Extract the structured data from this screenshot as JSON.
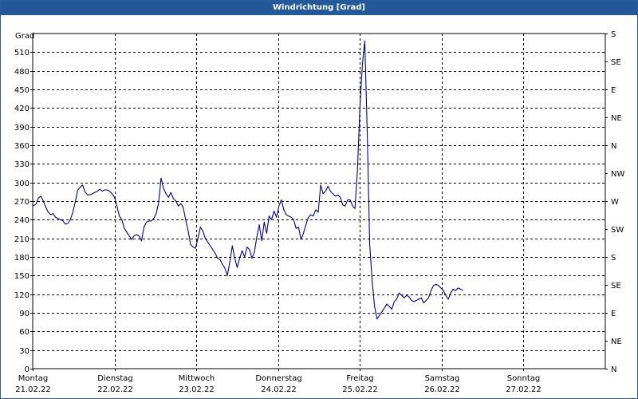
{
  "window": {
    "title": "Windrichtung [Grad]"
  },
  "chart_data": {
    "type": "line",
    "title": "Windrichtung [Grad]",
    "ylabel": "Grad",
    "ylim": [
      0,
      540
    ],
    "y_ticks": [
      0,
      30,
      60,
      90,
      120,
      150,
      180,
      210,
      240,
      270,
      300,
      330,
      360,
      390,
      420,
      450,
      480,
      510
    ],
    "y2_ticks": [
      {
        "value": 0,
        "label": "N"
      },
      {
        "value": 45,
        "label": "NE"
      },
      {
        "value": 90,
        "label": "E"
      },
      {
        "value": 135,
        "label": "SE"
      },
      {
        "value": 180,
        "label": "S"
      },
      {
        "value": 225,
        "label": "SW"
      },
      {
        "value": 270,
        "label": "W"
      },
      {
        "value": 315,
        "label": "NW"
      },
      {
        "value": 360,
        "label": "N"
      },
      {
        "value": 405,
        "label": "NE"
      },
      {
        "value": 450,
        "label": "E"
      },
      {
        "value": 495,
        "label": "SE"
      },
      {
        "value": 540,
        "label": "S"
      }
    ],
    "xlim": [
      0,
      7
    ],
    "x_ticks": [
      {
        "value": 0,
        "day": "Montag",
        "date": "21.02.22"
      },
      {
        "value": 1,
        "day": "Dienstag",
        "date": "22.02.22"
      },
      {
        "value": 2,
        "day": "Mittwoch",
        "date": "23.02.22"
      },
      {
        "value": 3,
        "day": "Donnerstag",
        "date": "24.02.22"
      },
      {
        "value": 4,
        "day": "Freitag",
        "date": "25.02.22"
      },
      {
        "value": 5,
        "day": "Samstag",
        "date": "26.02.22"
      },
      {
        "value": 6,
        "day": "Sonntag",
        "date": "27.02.22"
      }
    ],
    "grid": true,
    "series": [
      {
        "color": "#00008b",
        "points": [
          [
            0.0,
            262
          ],
          [
            0.04,
            265
          ],
          [
            0.07,
            275
          ],
          [
            0.1,
            278
          ],
          [
            0.13,
            270
          ],
          [
            0.16,
            260
          ],
          [
            0.19,
            252
          ],
          [
            0.22,
            248
          ],
          [
            0.25,
            250
          ],
          [
            0.28,
            244
          ],
          [
            0.31,
            242
          ],
          [
            0.34,
            240
          ],
          [
            0.37,
            238
          ],
          [
            0.4,
            233
          ],
          [
            0.43,
            234
          ],
          [
            0.46,
            240
          ],
          [
            0.49,
            252
          ],
          [
            0.52,
            268
          ],
          [
            0.55,
            288
          ],
          [
            0.58,
            292
          ],
          [
            0.61,
            296
          ],
          [
            0.64,
            285
          ],
          [
            0.67,
            280
          ],
          [
            0.7,
            280
          ],
          [
            0.73,
            282
          ],
          [
            0.76,
            284
          ],
          [
            0.79,
            286
          ],
          [
            0.82,
            289
          ],
          [
            0.85,
            286
          ],
          [
            0.88,
            288
          ],
          [
            0.91,
            288
          ],
          [
            0.94,
            286
          ],
          [
            0.97,
            282
          ],
          [
            1.0,
            276
          ],
          [
            1.03,
            262
          ],
          [
            1.06,
            246
          ],
          [
            1.09,
            240
          ],
          [
            1.12,
            226
          ],
          [
            1.15,
            220
          ],
          [
            1.18,
            214
          ],
          [
            1.21,
            208
          ],
          [
            1.24,
            214
          ],
          [
            1.27,
            216
          ],
          [
            1.3,
            214
          ],
          [
            1.33,
            206
          ],
          [
            1.36,
            228
          ],
          [
            1.39,
            236
          ],
          [
            1.42,
            238
          ],
          [
            1.45,
            238
          ],
          [
            1.48,
            242
          ],
          [
            1.51,
            250
          ],
          [
            1.54,
            268
          ],
          [
            1.57,
            307
          ],
          [
            1.6,
            290
          ],
          [
            1.63,
            282
          ],
          [
            1.66,
            276
          ],
          [
            1.69,
            284
          ],
          [
            1.72,
            274
          ],
          [
            1.75,
            270
          ],
          [
            1.78,
            262
          ],
          [
            1.81,
            266
          ],
          [
            1.84,
            260
          ],
          [
            1.87,
            240
          ],
          [
            1.9,
            222
          ],
          [
            1.93,
            200
          ],
          [
            1.96,
            196
          ],
          [
            1.99,
            194
          ],
          [
            2.02,
            210
          ],
          [
            2.05,
            228
          ],
          [
            2.08,
            222
          ],
          [
            2.11,
            210
          ],
          [
            2.14,
            204
          ],
          [
            2.17,
            198
          ],
          [
            2.2,
            192
          ],
          [
            2.23,
            186
          ],
          [
            2.26,
            178
          ],
          [
            2.29,
            176
          ],
          [
            2.32,
            168
          ],
          [
            2.35,
            162
          ],
          [
            2.38,
            150
          ],
          [
            2.41,
            172
          ],
          [
            2.44,
            198
          ],
          [
            2.47,
            178
          ],
          [
            2.5,
            163
          ],
          [
            2.53,
            178
          ],
          [
            2.56,
            190
          ],
          [
            2.59,
            180
          ],
          [
            2.62,
            196
          ],
          [
            2.65,
            192
          ],
          [
            2.68,
            178
          ],
          [
            2.71,
            188
          ],
          [
            2.74,
            212
          ],
          [
            2.77,
            232
          ],
          [
            2.8,
            206
          ],
          [
            2.83,
            236
          ],
          [
            2.86,
            218
          ],
          [
            2.89,
            246
          ],
          [
            2.92,
            240
          ],
          [
            2.95,
            254
          ],
          [
            2.98,
            244
          ],
          [
            3.01,
            262
          ],
          [
            3.04,
            272
          ],
          [
            3.07,
            256
          ],
          [
            3.1,
            248
          ],
          [
            3.13,
            246
          ],
          [
            3.16,
            244
          ],
          [
            3.19,
            240
          ],
          [
            3.22,
            226
          ],
          [
            3.25,
            228
          ],
          [
            3.28,
            208
          ],
          [
            3.31,
            218
          ],
          [
            3.34,
            232
          ],
          [
            3.37,
            244
          ],
          [
            3.4,
            248
          ],
          [
            3.43,
            246
          ],
          [
            3.46,
            256
          ],
          [
            3.49,
            252
          ],
          [
            3.52,
            296
          ],
          [
            3.55,
            282
          ],
          [
            3.58,
            286
          ],
          [
            3.61,
            294
          ],
          [
            3.64,
            286
          ],
          [
            3.67,
            282
          ],
          [
            3.7,
            278
          ],
          [
            3.73,
            280
          ],
          [
            3.76,
            276
          ],
          [
            3.79,
            264
          ],
          [
            3.82,
            262
          ],
          [
            3.85,
            272
          ],
          [
            3.88,
            272
          ],
          [
            3.91,
            262
          ],
          [
            3.94,
            258
          ],
          [
            3.97,
            320
          ],
          [
            4.0,
            420
          ],
          [
            4.03,
            490
          ],
          [
            4.06,
            528
          ],
          [
            4.09,
            380
          ],
          [
            4.12,
            200
          ],
          [
            4.15,
            140
          ],
          [
            4.18,
            100
          ],
          [
            4.21,
            80
          ],
          [
            4.24,
            86
          ],
          [
            4.27,
            92
          ],
          [
            4.3,
            98
          ],
          [
            4.33,
            104
          ],
          [
            4.36,
            100
          ],
          [
            4.39,
            96
          ],
          [
            4.42,
            108
          ],
          [
            4.45,
            112
          ],
          [
            4.48,
            122
          ],
          [
            4.51,
            118
          ],
          [
            4.54,
            114
          ],
          [
            4.57,
            118
          ],
          [
            4.6,
            116
          ],
          [
            4.63,
            110
          ],
          [
            4.66,
            108
          ],
          [
            4.69,
            110
          ],
          [
            4.72,
            112
          ],
          [
            4.75,
            114
          ],
          [
            4.78,
            106
          ],
          [
            4.81,
            110
          ],
          [
            4.84,
            114
          ],
          [
            4.87,
            126
          ],
          [
            4.9,
            134
          ],
          [
            4.93,
            136
          ],
          [
            4.96,
            134
          ],
          [
            4.99,
            130
          ],
          [
            5.02,
            126
          ],
          [
            5.05,
            118
          ],
          [
            5.08,
            112
          ],
          [
            5.11,
            122
          ],
          [
            5.14,
            128
          ],
          [
            5.17,
            126
          ],
          [
            5.2,
            130
          ],
          [
            5.23,
            128
          ],
          [
            5.26,
            126
          ]
        ]
      }
    ]
  }
}
